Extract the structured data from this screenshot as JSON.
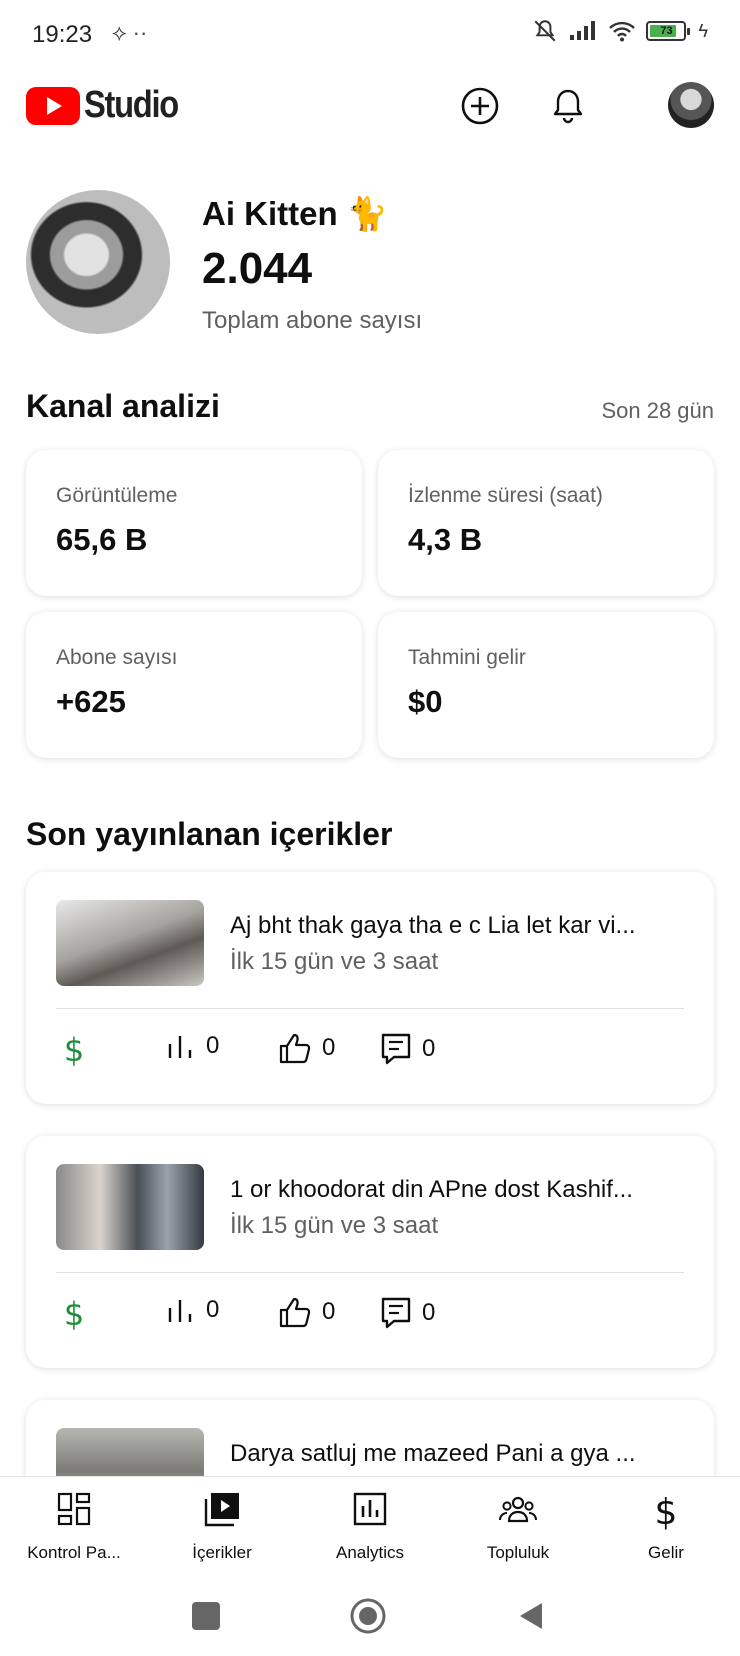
{
  "status_bar": {
    "time": "19:23",
    "battery_level": "73"
  },
  "header": {
    "app_name": "Studio",
    "create_icon": "add-circle-icon",
    "notifications_icon": "bell-icon"
  },
  "channel": {
    "name": "Ai Kitten 🐈",
    "subscriber_count": "2.044",
    "subscriber_label": "Toplam abone sayısı"
  },
  "analytics": {
    "title": "Kanal analizi",
    "period": "Son 28 gün",
    "cards": [
      {
        "label": "Görüntüleme",
        "value": "65,6 B"
      },
      {
        "label": "İzlenme süresi (saat)",
        "value": "4,3 B"
      },
      {
        "label": "Abone sayısı",
        "value": "+625"
      },
      {
        "label": "Tahmini gelir",
        "value": "$0"
      }
    ]
  },
  "recent": {
    "title": "Son yayınlanan içerikler",
    "items": [
      {
        "title": "Aj bht thak gaya tha e c Lia let kar vi...",
        "subtitle": "İlk 15 gün ve 3 saat",
        "views": "0",
        "likes": "0",
        "comments": "0"
      },
      {
        "title": "1 or khoodorat din APne dost Kashif...",
        "subtitle": "İlk 15 gün ve 3 saat",
        "views": "0",
        "likes": "0",
        "comments": "0"
      },
      {
        "title": "Darya satluj me mazeed Pani a gya ..."
      }
    ]
  },
  "bottom_nav": [
    {
      "label": "Kontrol Pa...",
      "icon": "dashboard-icon"
    },
    {
      "label": "İçerikler",
      "icon": "content-icon"
    },
    {
      "label": "Analytics",
      "icon": "analytics-icon"
    },
    {
      "label": "Topluluk",
      "icon": "community-icon"
    },
    {
      "label": "Gelir",
      "icon": "dollar-icon"
    }
  ],
  "colors": {
    "brand_red": "#ff0000",
    "money_green": "#1e8e3e",
    "secondary_text": "#606060"
  }
}
